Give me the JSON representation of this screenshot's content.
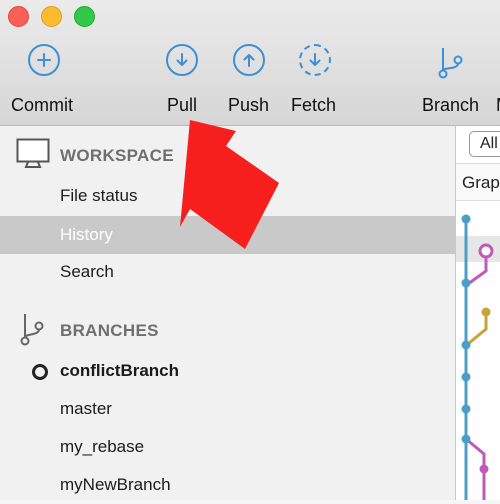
{
  "window": {
    "traffic_lights": {
      "close": "#fc5f57",
      "minimize": "#fdbc2e",
      "zoom": "#34c84a"
    }
  },
  "toolbar": {
    "commit_label": "Commit",
    "pull_label": "Pull",
    "push_label": "Push",
    "fetch_label": "Fetch",
    "branch_label": "Branch",
    "cut_label": "M",
    "accent": "#3d8fd6"
  },
  "sidebar": {
    "workspace_title": "WORKSPACE",
    "workspace_items": [
      "File status",
      "History",
      "Search"
    ],
    "selected_item": "History",
    "branches_title": "BRANCHES",
    "branches": [
      "conflictBranch",
      "master",
      "my_rebase",
      "myNewBranch"
    ],
    "current_branch": "conflictBranch"
  },
  "history": {
    "filter_label": "All",
    "graph_header": "Grap",
    "graph_colors": [
      "#4a9ec7",
      "#c15ab7",
      "#c9a33a"
    ]
  },
  "annotation": {
    "arrow_color": "#f71e1e"
  }
}
